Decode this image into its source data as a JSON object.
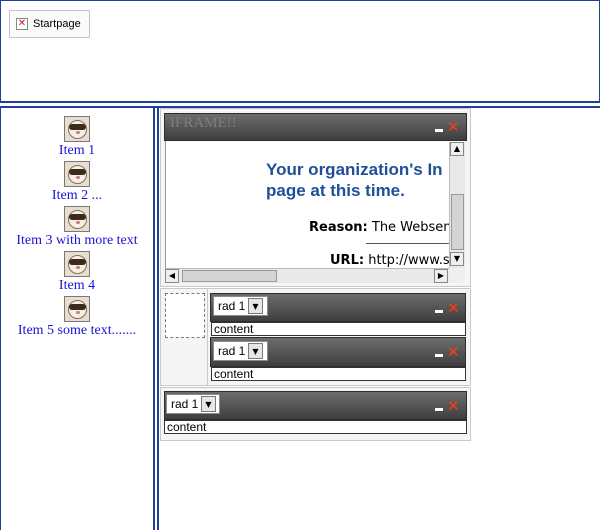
{
  "top": {
    "start_tab": {
      "label": "Startpage",
      "icon": "close-x-icon"
    }
  },
  "sidebar": {
    "items": [
      {
        "label": "Item 1",
        "icon": "ferret-icon"
      },
      {
        "label": "Item 2 ...",
        "icon": "ferret-icon"
      },
      {
        "label": "Item 3 with more text",
        "icon": "ferret-icon"
      },
      {
        "label": "Item 4",
        "icon": "ferret-icon"
      },
      {
        "label": "Item 5 some text.......",
        "icon": "ferret-icon"
      }
    ]
  },
  "iframe_widget": {
    "title": "IFRAME!!",
    "heading": "Your organization's In\npage at this time.",
    "reason_label": "Reason:",
    "reason_text": "The Websens",
    "url_label": "URL:",
    "url_text": "http://www.s"
  },
  "widgets": [
    {
      "select_value": "rad 1",
      "content": "content"
    },
    {
      "select_value": "rad 1",
      "content": "content"
    },
    {
      "select_value": "rad 1",
      "content": "content"
    }
  ],
  "colors": {
    "frame_blue": "#1e3f9a",
    "link_blue": "#1a12d6",
    "close_red": "#ff3a13",
    "heading_blue": "#1f4e9a"
  }
}
